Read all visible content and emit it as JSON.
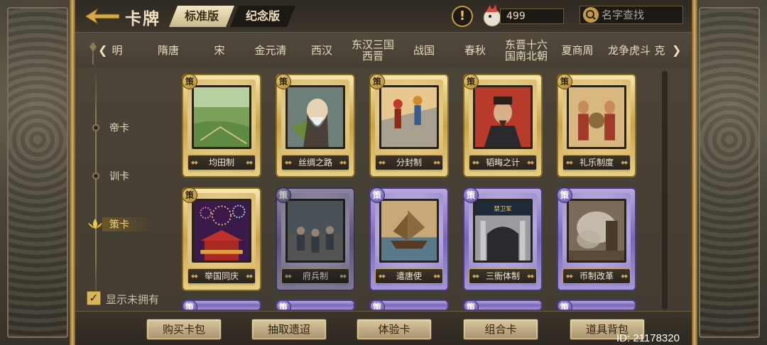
{
  "header": {
    "title": "卡牌",
    "version_tabs": [
      "标准版",
      "纪念版"
    ],
    "currency_amount": "499",
    "search_placeholder": "名字查找"
  },
  "eras": [
    "明",
    "隋唐",
    "宋",
    "金元清",
    "西汉",
    "东汉三国\n西晋",
    "战国",
    "春秋",
    "东晋十六\n国南北朝",
    "夏商周",
    "龙争虎斗",
    "克"
  ],
  "categories": [
    {
      "label": "帝卡",
      "active": false
    },
    {
      "label": "训卡",
      "active": false
    },
    {
      "label": "策卡",
      "active": true
    }
  ],
  "show_unowned_label": "显示未拥有",
  "show_unowned_checked": true,
  "card_badge": "策",
  "cards": [
    {
      "name": "均田制",
      "rarity": "gold",
      "owned": true,
      "art": "field"
    },
    {
      "name": "丝绸之路",
      "rarity": "gold",
      "owned": true,
      "art": "sage"
    },
    {
      "name": "分封制",
      "rarity": "gold",
      "owned": true,
      "art": "court"
    },
    {
      "name": "韬晦之计",
      "rarity": "gold",
      "owned": true,
      "art": "man"
    },
    {
      "name": "礼乐制度",
      "rarity": "gold",
      "owned": true,
      "art": "ritual"
    },
    {
      "name": "举国同庆",
      "rarity": "gold",
      "owned": true,
      "art": "fireworks"
    },
    {
      "name": "府兵制",
      "rarity": "purple",
      "owned": false,
      "art": "soldiers"
    },
    {
      "name": "遣唐使",
      "rarity": "purple",
      "owned": true,
      "art": "ship"
    },
    {
      "name": "三衙体制",
      "rarity": "purple",
      "owned": true,
      "art": "gate"
    },
    {
      "name": "币制改革",
      "rarity": "purple",
      "owned": true,
      "art": "smoke"
    }
  ],
  "buttons": [
    "购买卡包",
    "抽取遗迢",
    "体验卡",
    "组合卡",
    "道具背包"
  ],
  "id_text": "ID: 21178320"
}
